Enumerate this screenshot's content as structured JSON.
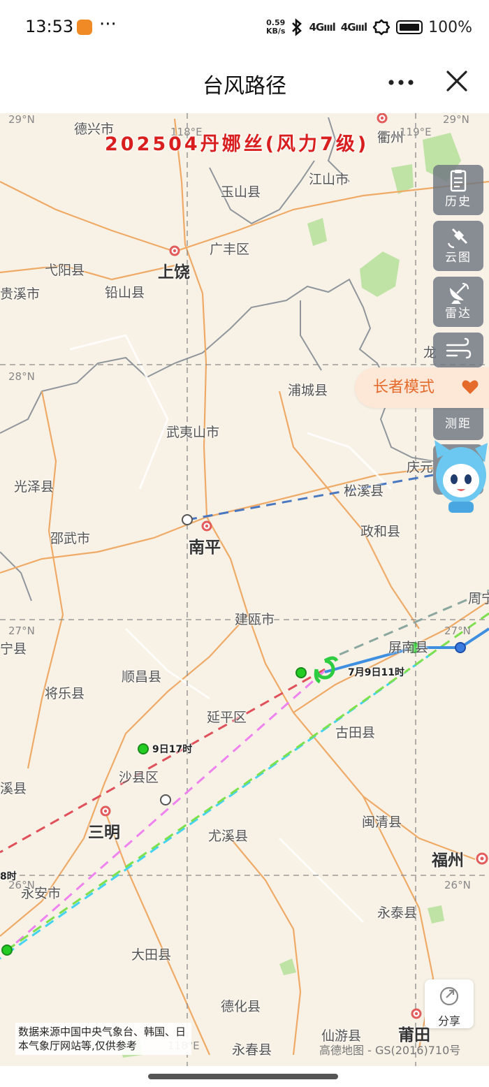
{
  "status_bar": {
    "time": "13:53",
    "more": "···",
    "net_speed_value": "0.59",
    "net_speed_unit": "KB/s",
    "signal_1": "4Gıııl",
    "signal_2": "4Gıııl",
    "battery": "100%"
  },
  "header": {
    "title": "台风路径",
    "more_icon": "ellipsis-icon",
    "close_icon": "close-icon"
  },
  "storm": {
    "title": "202504丹娜丝(风力7级)",
    "current_time_label": "7月9日11时",
    "forecast_time_label": "9日17时",
    "edge_time_label": "8时"
  },
  "toolbar": {
    "history": "历史",
    "cloud": "云图",
    "radar": "雷达",
    "measure": "测距"
  },
  "elder_mode": {
    "label": "长者模式"
  },
  "map": {
    "coords": [
      "29°N",
      "118°E",
      "119°E",
      "29°N",
      "28°N",
      "27°N",
      "27°N",
      "26°N",
      "26°N",
      "118°E"
    ],
    "cities": [
      "上饶",
      "南平",
      "三明",
      "福州",
      "莆田"
    ],
    "places": [
      "德兴市",
      "衢州",
      "江山市",
      "玉山县",
      "广丰区",
      "弋阳县",
      "贵溪市",
      "铅山县",
      "浦城县",
      "武夷山市",
      "光泽县",
      "松溪县",
      "庆元",
      "邵武市",
      "政和县",
      "周宁",
      "建瓯市",
      "屏南县",
      "宁县",
      "顺昌县",
      "将乐县",
      "延平区",
      "古田县",
      "沙县区",
      "溪县",
      "尤溪县",
      "闽清县",
      "永安市",
      "永泰县",
      "大田县",
      "德化县",
      "仙游县",
      "永春县",
      "龙"
    ],
    "tracks": {
      "colors": {
        "observed": "#3f8fe0",
        "china": "#e0505a",
        "japan": "#ee82ee",
        "korea": "#44d2f0",
        "other": "#7de04c",
        "grey": "#8aa7a0",
        "north": "#4a78c0"
      },
      "point_colors": {
        "past": "#3b7be0",
        "forecast": "#22cc22"
      }
    }
  },
  "share": {
    "label": "分享"
  },
  "source_note": "数据来源中国中央气象台、韩国、日本气象厅网站等,仅供参考",
  "copyright": "高德地图 - GS(2016)710号"
}
